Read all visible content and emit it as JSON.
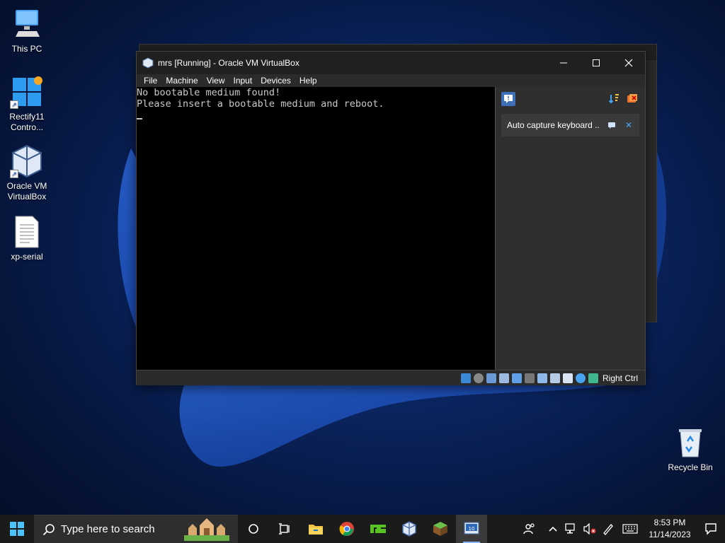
{
  "desktop": {
    "icons": [
      {
        "label": "This PC"
      },
      {
        "label": "Rectify11 Contro..."
      },
      {
        "label": "Oracle VM VirtualBox"
      },
      {
        "label": "xp-serial"
      },
      {
        "label": "Recycle Bin"
      }
    ]
  },
  "vm_window": {
    "title": "mrs [Running] - Oracle VM VirtualBox",
    "menu": [
      "File",
      "Machine",
      "View",
      "Input",
      "Devices",
      "Help"
    ],
    "screen_lines": [
      "No bootable medium found!",
      "Please insert a bootable medium and reboot."
    ],
    "notice_text": "Auto capture keyboard ...",
    "host_key_label": "Right Ctrl"
  },
  "taskbar": {
    "search_placeholder": "Type here to search",
    "time": "8:53 PM",
    "date": "11/14/2023"
  },
  "colors": {
    "accent": "#8ab4f8",
    "taskbar_bg": "#1b1b1b",
    "desktop_bg": "#0b2560"
  }
}
